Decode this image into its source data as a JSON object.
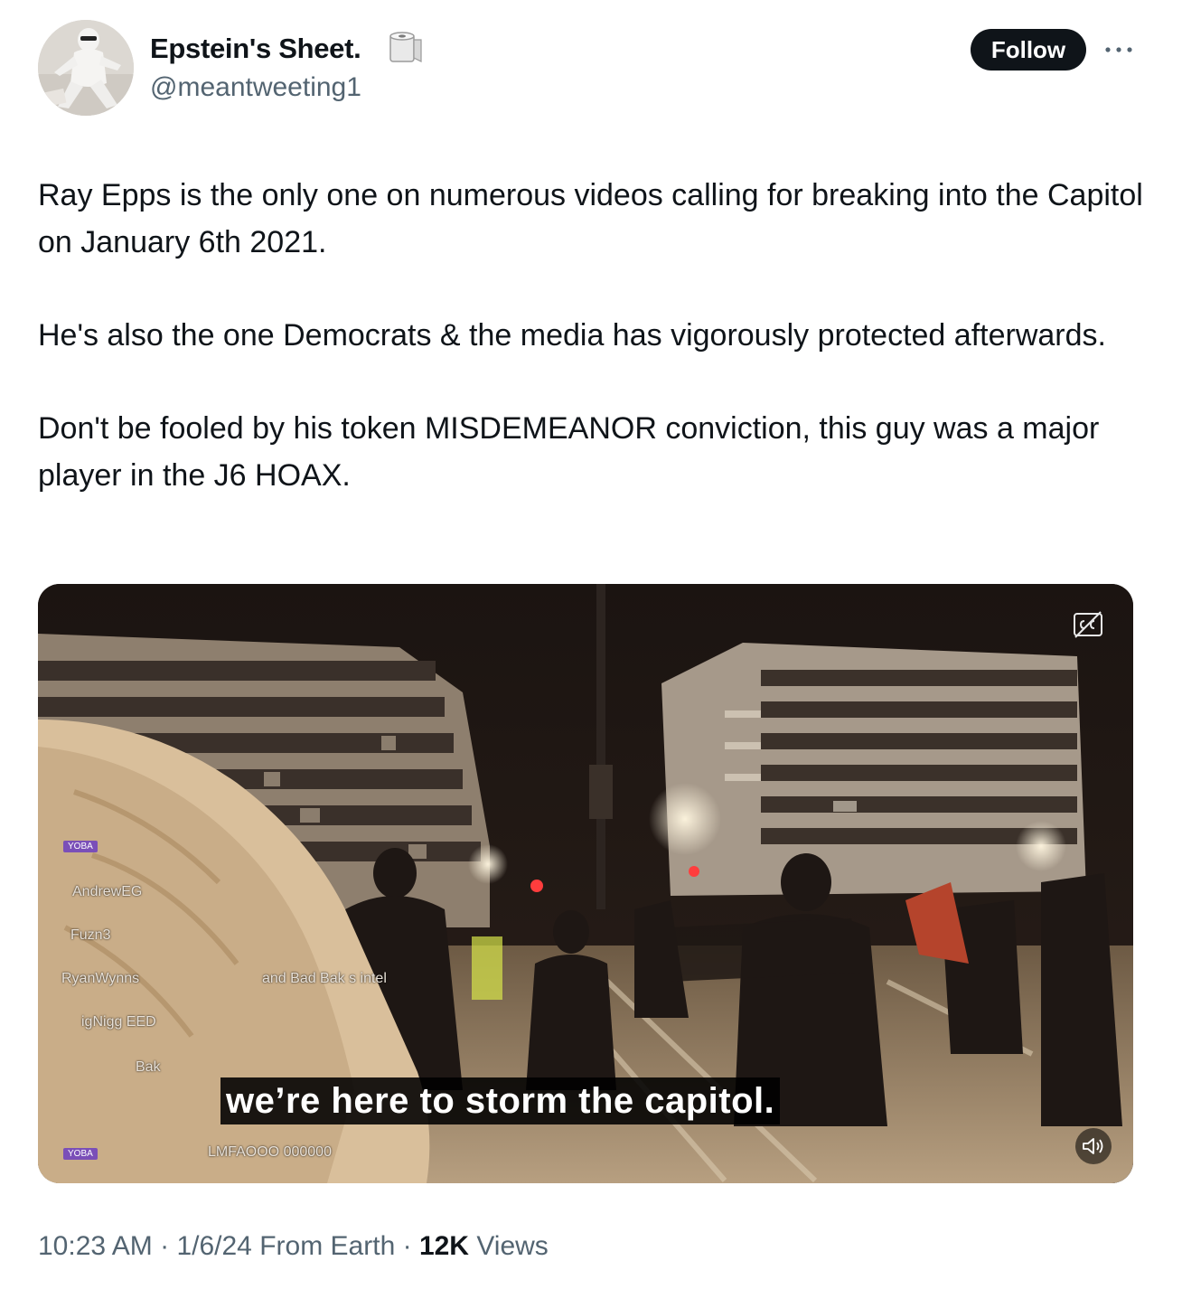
{
  "author": {
    "display_name": "Epstein's Sheet.",
    "handle": "@meantweeting1",
    "name_emoji": "toilet-paper-roll-emoji"
  },
  "actions": {
    "follow_label": "Follow",
    "more_icon": "more-dots-icon"
  },
  "tweet": {
    "paragraphs": [
      "Ray Epps is the only one on numerous videos calling for breaking into the Capitol on January 6th 2021.",
      "He's also the one Democrats & the media has vigorously protected afterwards.",
      "Don't be fooled by his token MISDEMEANOR conviction, this guy was a major player in the J6 HOAX."
    ]
  },
  "media": {
    "caption": "we’re here to storm the capitol.",
    "captions_icon": "closed-captions-icon",
    "mute_icon": "speaker-icon",
    "chat_overlay": {
      "badges": [
        "YOBA",
        "YOBA"
      ],
      "lines": [
        "AndrewEG",
        "Fuzn3",
        "RyanWynns",
        "and Bad Bak  s intel",
        "igNigg  EED",
        "Bak",
        "LMFAOOO  000000"
      ]
    }
  },
  "meta": {
    "time": "10:23 AM",
    "separator": "·",
    "date": "1/6/24",
    "source": "From Earth",
    "views_count": "12K",
    "views_label": "Views"
  },
  "colors": {
    "text_primary": "#0f1419",
    "text_secondary": "#536471",
    "follow_bg": "#0f1419",
    "follow_text": "#ffffff"
  }
}
